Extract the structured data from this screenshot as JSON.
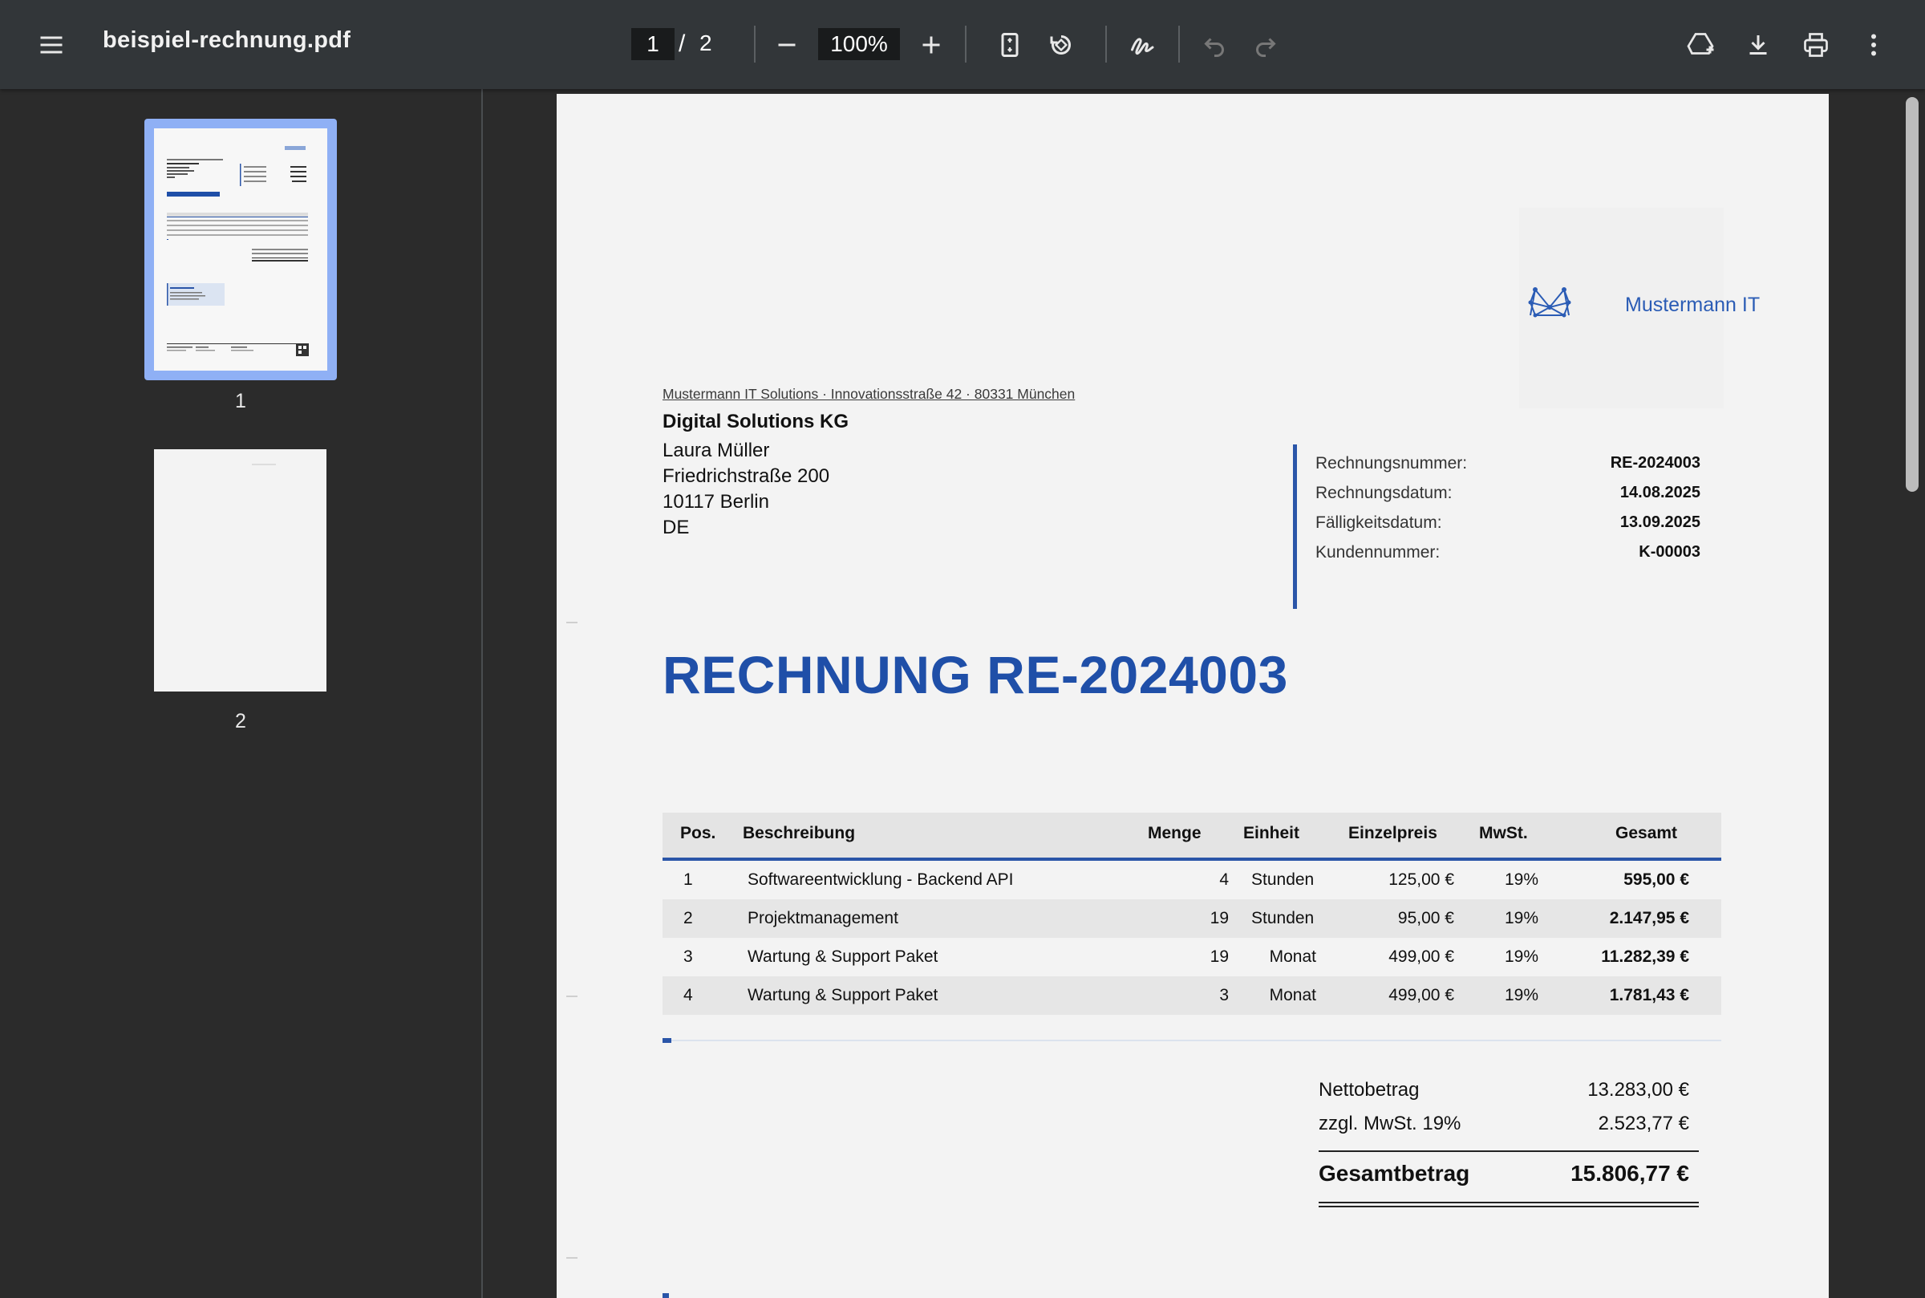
{
  "toolbar": {
    "title": "beispiel-rechnung.pdf",
    "current_page": "1",
    "page_separator": "/",
    "total_pages": "2",
    "zoom": "100%"
  },
  "sidebar": {
    "thumbnails": [
      {
        "label": "1"
      },
      {
        "label": "2"
      }
    ]
  },
  "invoice": {
    "logo_text": "Mustermann IT",
    "sender_line": "Mustermann IT Solutions · Innovationsstraße 42 · 80331 München",
    "customer": {
      "company": "Digital Solutions KG",
      "name": "Laura Müller",
      "street": "Friedrichstraße 200",
      "city": "10117 Berlin",
      "country": "DE"
    },
    "meta": [
      {
        "label": "Rechnungsnummer:",
        "value": "RE-2024003"
      },
      {
        "label": "Rechnungsdatum:",
        "value": "14.08.2025"
      },
      {
        "label": "Fälligkeitsdatum:",
        "value": "13.09.2025"
      },
      {
        "label": "Kundennummer:",
        "value": "K-00003"
      }
    ],
    "headline": "RECHNUNG RE-2024003",
    "table": {
      "headers": [
        "Pos.",
        "Beschreibung",
        "Menge",
        "Einheit",
        "Einzelpreis",
        "MwSt.",
        "Gesamt"
      ],
      "rows": [
        {
          "pos": "1",
          "desc": "Softwareentwicklung - Backend API",
          "qty": "4",
          "unit": "Stunden",
          "price": "125,00 €",
          "vat": "19%",
          "total": "595,00 €"
        },
        {
          "pos": "2",
          "desc": "Projektmanagement",
          "qty": "19",
          "unit": "Stunden",
          "price": "95,00 €",
          "vat": "19%",
          "total": "2.147,95 €"
        },
        {
          "pos": "3",
          "desc": "Wartung & Support Paket",
          "qty": "19",
          "unit": "Monat",
          "price": "499,00 €",
          "vat": "19%",
          "total": "11.282,39 €"
        },
        {
          "pos": "4",
          "desc": "Wartung & Support Paket",
          "qty": "3",
          "unit": "Monat",
          "price": "499,00 €",
          "vat": "19%",
          "total": "1.781,43 €"
        }
      ]
    },
    "summary": {
      "net_label": "Nettobetrag",
      "net_value": "13.283,00 €",
      "vat_label": "zzgl. MwSt. 19%",
      "vat_value": "2.523,77 €",
      "total_label": "Gesamtbetrag",
      "total_value": "15.806,77 €"
    }
  },
  "colors": {
    "accent": "#1f4fa8",
    "toolbar_bg": "#323639",
    "viewer_bg": "#2b2b2b",
    "page_bg": "#f3f3f3"
  }
}
